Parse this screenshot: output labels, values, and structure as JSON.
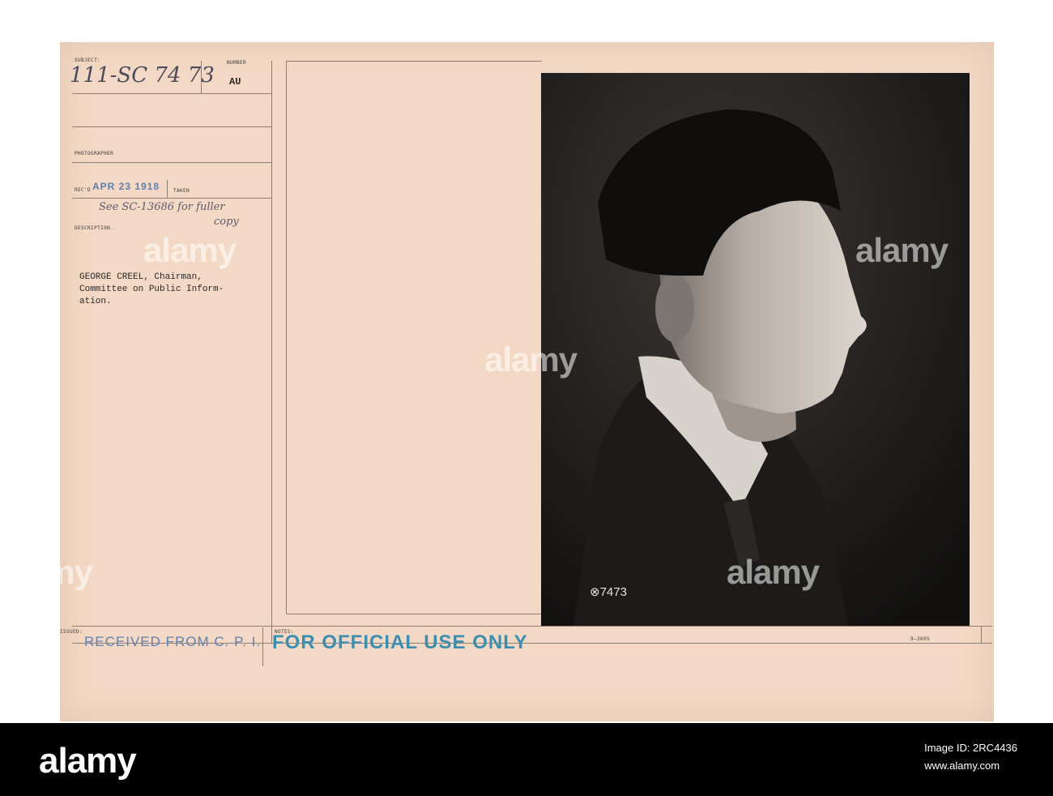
{
  "card": {
    "subject_label": "SUBJECT:",
    "subject_value": "111-SC 74 73",
    "number_label": "NUMBER",
    "number_value": "AU",
    "photographer_label": "PHOTOGRAPHER",
    "recd_label": "REC'D",
    "recd_date": "APR 23 1918",
    "taken_label": "TAKEN",
    "handwritten_note_line1": "See SC-13686 for fuller",
    "handwritten_note_line2": "copy",
    "description_label": "DESCRIPTION.",
    "description_lines": [
      "GEORGE CREEL, Chairman,",
      "Committee on Public Inform-",
      "ation."
    ],
    "issued_label": "ISSUED:",
    "issued_stamp": "RECEIVED FROM C. P. I.",
    "notes_label": "NOTES:",
    "notes_stamp": "FOR OFFICIAL USE ONLY",
    "photo_number": "⊗7473",
    "form_number": "9—3605"
  },
  "watermark": {
    "text": "alamy"
  },
  "footer": {
    "logo": "alamy",
    "image_id_label": "Image ID: 2RC4436",
    "site": "www.alamy.com"
  },
  "colors": {
    "card": "#f3d9c5",
    "stamp_blue": "#5f7fb1",
    "stamp_teal": "#3a8fb0",
    "photo_bg": "#151413",
    "footer_bg": "#000000"
  }
}
